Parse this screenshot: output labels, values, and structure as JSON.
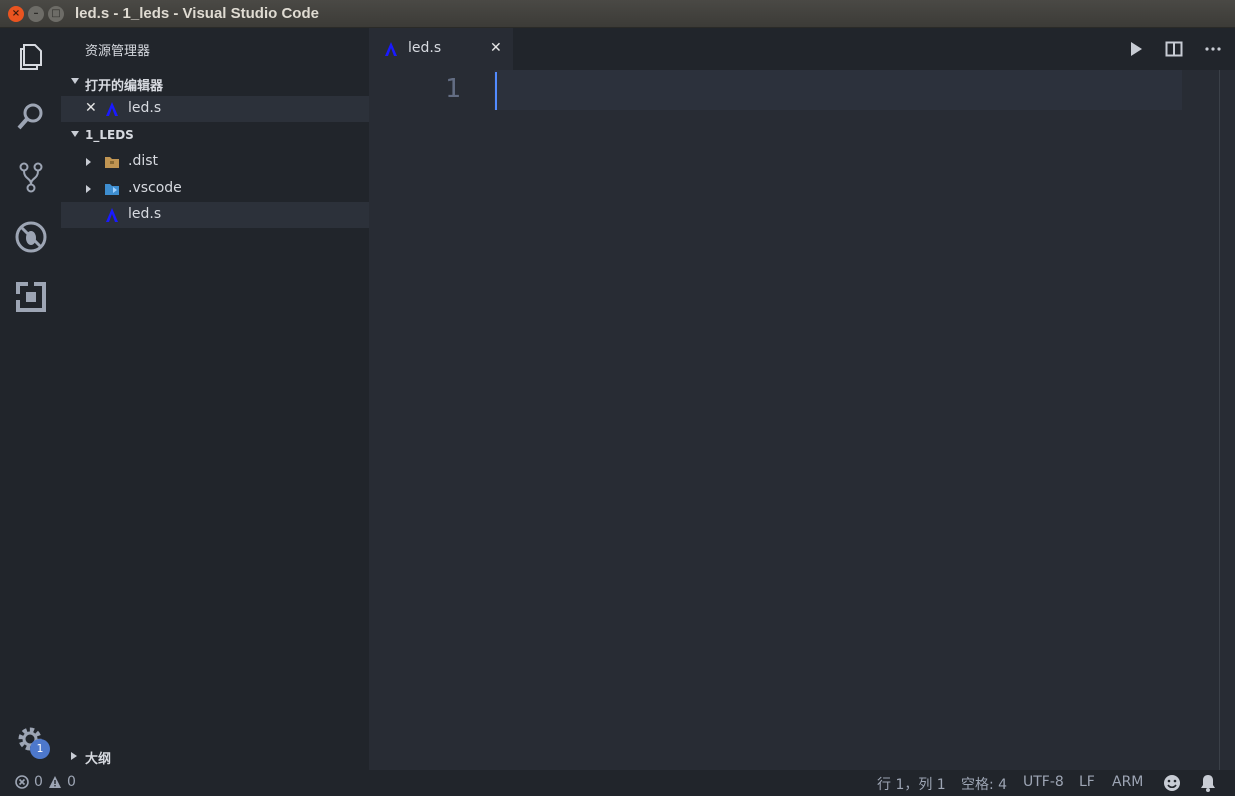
{
  "window": {
    "title": "led.s - 1_leds - Visual Studio Code",
    "close_glyph": "×",
    "min_glyph": "–",
    "max_glyph": "□"
  },
  "activity_bar": {
    "items": [
      "files-icon",
      "search-icon",
      "source-control-icon",
      "debug-icon",
      "extensions-icon"
    ],
    "settings_badge": "1"
  },
  "sidebar": {
    "title": "资源管理器",
    "open_editors": {
      "label": "打开的编辑器",
      "items": [
        {
          "close_glyph": "✕",
          "name": "led.s"
        }
      ]
    },
    "folder": {
      "label": "1_LEDS",
      "items": [
        {
          "name": ".dist",
          "type": "folder"
        },
        {
          "name": ".vscode",
          "type": "folder"
        },
        {
          "name": "led.s",
          "type": "file"
        }
      ]
    },
    "outline": {
      "label": "大纲"
    }
  },
  "tabs": [
    {
      "label": "led.s",
      "close_glyph": "✕",
      "active": true
    }
  ],
  "editor": {
    "line_numbers": [
      "1"
    ]
  },
  "status": {
    "errors": "0",
    "warnings": "0",
    "position": "行 1，列 1",
    "spaces": "空格: 4",
    "encoding": "UTF-8",
    "eol": "LF",
    "language": "ARM"
  },
  "colors": {
    "accent": "#528bff",
    "badge": "#4d78cc",
    "asm_icon": "#1a1aff"
  }
}
